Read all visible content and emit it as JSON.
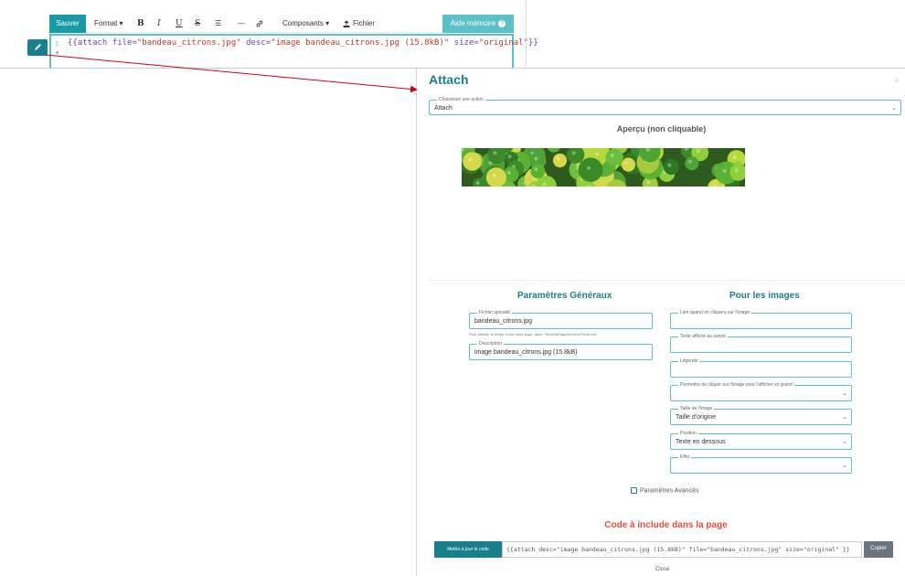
{
  "toolbar": {
    "save": "Sauver",
    "format": "Format ▾",
    "bold": "B",
    "italic": "I",
    "underline": "U",
    "strike": "S",
    "list": "☰",
    "hr": "—",
    "link": "🔗",
    "components": "Composants ▾",
    "file": "Fichier",
    "help": "Aide mémoire"
  },
  "editor": {
    "line_number": "1",
    "code_open": "{{",
    "code_keyword": "attach",
    "attr_file": "file=",
    "val_file": "\"bandeau_citrons.jpg\"",
    "attr_desc": "desc=",
    "val_desc": "\"image bandeau_citrons.jpg (15.8kB)\"",
    "attr_size": "size=",
    "val_size": "\"original\"",
    "code_close": "}}"
  },
  "modal": {
    "title": "Attach",
    "close_icon": "×",
    "action_legend": "Choisissez une action",
    "action_value": "Attach",
    "preview_title": "Aperçu (non cliquable)",
    "general_title": "Paramètres Généraux",
    "images_title": "Pour les images",
    "file_legend": "Fichier uploadé",
    "file_value": "bandeau_citrons.jpg",
    "file_hint": "Pour afficher le fichier d'une autre page, taper \"NomDePage/NomDeFichier.ext\"",
    "desc_legend": "Description",
    "desc_value": "image bandeau_citrons.jpg (15.8kB)",
    "link_legend": "Lien quand on cliquera sur l'image",
    "hover_legend": "Texte affiché au survol",
    "caption_legend": "Légende",
    "enlarge_legend": "Permettre de cliquer sur l'image pour l'afficher en grand",
    "size_legend": "Taille de l'image",
    "size_value": "Taille d'origine",
    "position_legend": "Position",
    "position_value": "Texte en dessous",
    "effect_legend": "Effet",
    "advanced_label": "Paramètres Avancés",
    "code_title": "Code à include dans la page",
    "update_button": "Mettre à jour le code",
    "code_output": "{{attach desc=\"image bandeau_citrons.jpg (15.8kB)\" file=\"bandeau_citrons.jpg\" size=\"original\" }}",
    "copy_button": "Copier",
    "close_link": "Close"
  },
  "colors": {
    "teal": "#1a7f8c",
    "teal_light": "#5cc0c8",
    "red": "#e74c3c",
    "arrow": "#d0021b"
  }
}
